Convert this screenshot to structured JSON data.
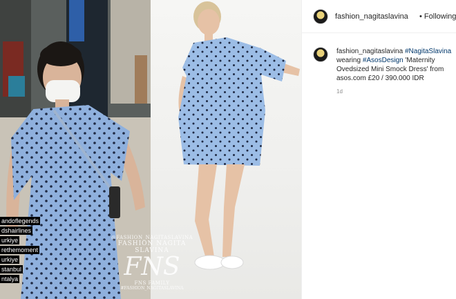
{
  "header": {
    "username": "fashion_nagitaslavina",
    "separator": "•",
    "follow_status": "Following"
  },
  "caption": {
    "username": "fashion_nagitaslavina",
    "text_parts": [
      {
        "text": "#NagitaSlavina",
        "tag": true
      },
      {
        "text": " wearing ",
        "tag": false
      },
      {
        "text": "#AsosDesign",
        "tag": true
      },
      {
        "text": " 'Maternity Ovedsized Mini Smock Dress' from asos.com £20 / 390.000 IDR",
        "tag": false
      }
    ],
    "age": "1d"
  },
  "story_tags": [
    "andoflegends",
    "dshairlines",
    "urkiye",
    "rethemoment",
    "urkiye",
    "stanbul",
    "ntalya"
  ],
  "watermark": {
    "line1": "@FASHION_NAGITASLAVINA",
    "line2": "FASHION NAGITA SLAVINA",
    "logo": "FNS",
    "line3": "FNS FAMILY",
    "line4": "#FASHION_NAGITASLAVINA"
  },
  "colors": {
    "dress": "#8fb0dd",
    "dots": "#1f2a44",
    "text": "#262626",
    "link": "#00376b",
    "muted": "#8e8e8e"
  }
}
